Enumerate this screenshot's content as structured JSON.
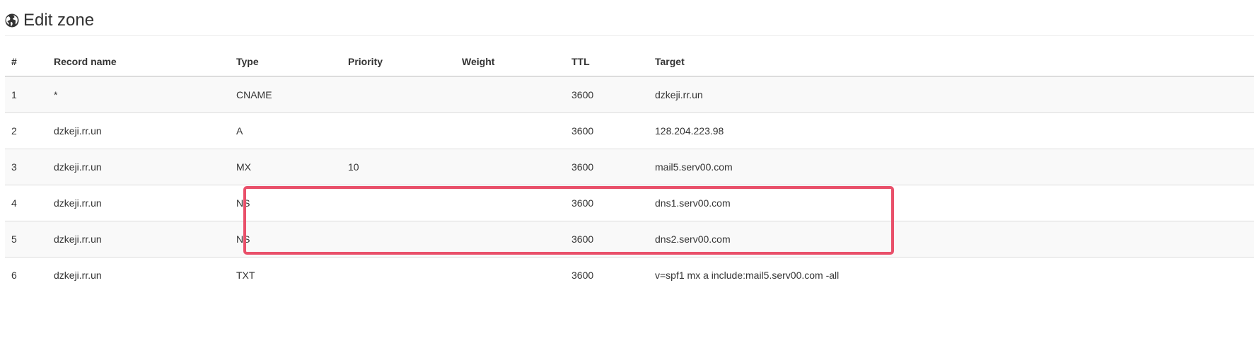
{
  "header": {
    "title": "Edit zone",
    "icon": "globe-icon"
  },
  "table": {
    "columns": [
      "#",
      "Record name",
      "Type",
      "Priority",
      "Weight",
      "TTL",
      "Target"
    ],
    "rows": [
      {
        "num": "1",
        "name": "*",
        "type": "CNAME",
        "priority": "",
        "weight": "",
        "ttl": "3600",
        "target": "dzkeji.rr.un"
      },
      {
        "num": "2",
        "name": "dzkeji.rr.un",
        "type": "A",
        "priority": "",
        "weight": "",
        "ttl": "3600",
        "target": "128.204.223.98"
      },
      {
        "num": "3",
        "name": "dzkeji.rr.un",
        "type": "MX",
        "priority": "10",
        "weight": "",
        "ttl": "3600",
        "target": "mail5.serv00.com"
      },
      {
        "num": "4",
        "name": "dzkeji.rr.un",
        "type": "NS",
        "priority": "",
        "weight": "",
        "ttl": "3600",
        "target": "dns1.serv00.com"
      },
      {
        "num": "5",
        "name": "dzkeji.rr.un",
        "type": "NS",
        "priority": "",
        "weight": "",
        "ttl": "3600",
        "target": "dns2.serv00.com"
      },
      {
        "num": "6",
        "name": "dzkeji.rr.un",
        "type": "TXT",
        "priority": "",
        "weight": "",
        "ttl": "3600",
        "target": "v=spf1 mx a include:mail5.serv00.com -all"
      }
    ]
  },
  "highlight": {
    "color": "#e9506a"
  }
}
